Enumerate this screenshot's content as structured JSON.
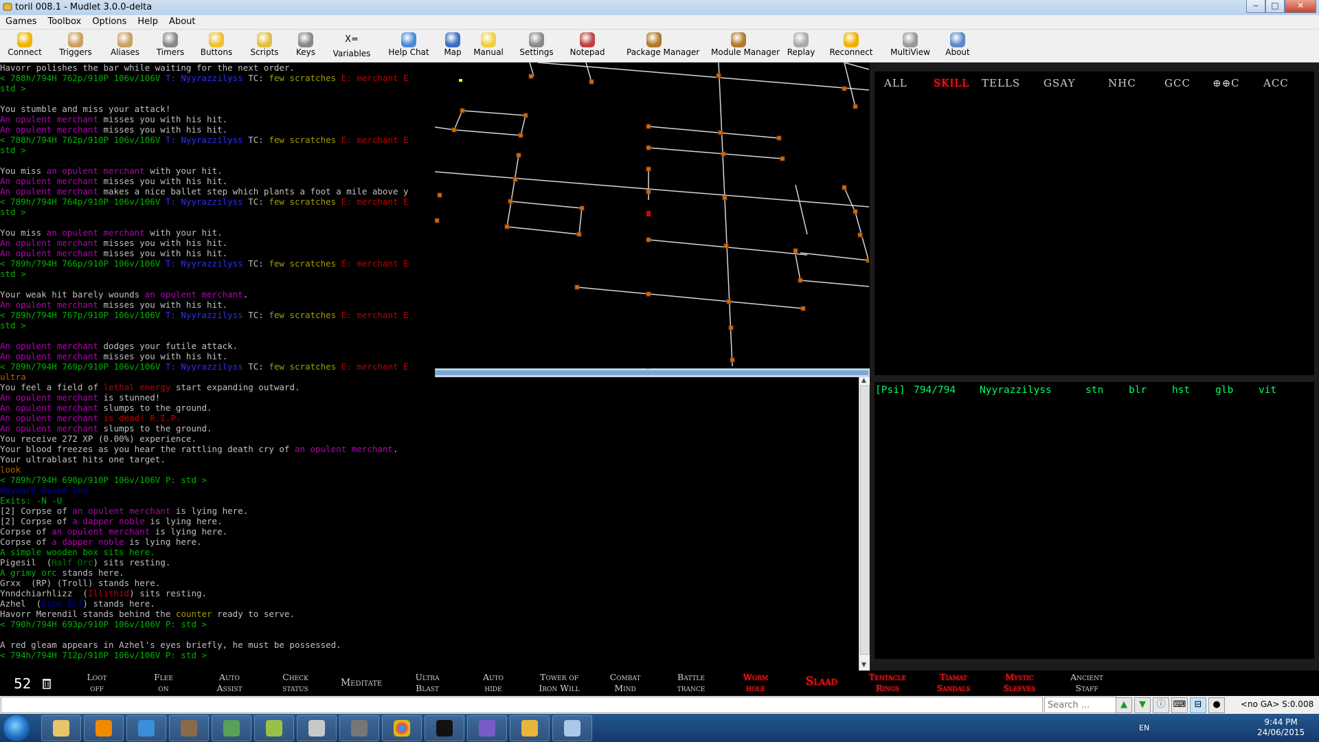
{
  "window": {
    "title": "toril 008.1 - Mudlet 3.0.0-delta",
    "minimize": "‒",
    "maximize": "□",
    "close": "✕"
  },
  "menu": [
    "Games",
    "Toolbox",
    "Options",
    "Help",
    "About"
  ],
  "toolbar": [
    {
      "label": "Connect",
      "icon": "connect-icon"
    },
    {
      "label": "Triggers",
      "icon": "triggers-icon"
    },
    {
      "label": "Aliases",
      "icon": "aliases-icon"
    },
    {
      "label": "Timers",
      "icon": "timers-icon"
    },
    {
      "label": "Buttons",
      "icon": "buttons-icon"
    },
    {
      "label": "Scripts",
      "icon": "scripts-icon"
    },
    {
      "label": "Keys",
      "icon": "keys-icon"
    },
    {
      "label": "Variables",
      "icon": "variables-icon",
      "glyph": "X="
    },
    {
      "label": "Help Chat",
      "icon": "help-chat-icon"
    },
    {
      "label": "Map",
      "icon": "map-icon"
    },
    {
      "label": "Manual",
      "icon": "manual-icon"
    },
    {
      "label": "Settings",
      "icon": "settings-icon"
    },
    {
      "label": "Notepad",
      "icon": "notepad-icon"
    },
    {
      "label": "Package Manager",
      "icon": "package-manager-icon"
    },
    {
      "label": "Module Manager",
      "icon": "module-manager-icon"
    },
    {
      "label": "Replay",
      "icon": "replay-icon"
    },
    {
      "label": "Reconnect",
      "icon": "reconnect-icon"
    },
    {
      "label": "MultiView",
      "icon": "multiview-icon"
    },
    {
      "label": "About",
      "icon": "about-icon"
    }
  ],
  "console": [
    [
      [
        "w",
        "Havorr polishes the bar while waiting for the next order."
      ]
    ],
    [
      [
        "g",
        "< 788h/794H 762p/910P 106v/106V "
      ],
      [
        "b",
        "T: Nyyrazzilyss"
      ],
      [
        "w",
        " TC: "
      ],
      [
        "y",
        "few scratches"
      ],
      [
        "r",
        " E: merchant E"
      ]
    ],
    [
      [
        "g",
        "std >"
      ]
    ],
    [
      [
        "w",
        ""
      ]
    ],
    [
      [
        "w",
        "You stumble and miss your attack!"
      ]
    ],
    [
      [
        "p",
        "An opulent merchant"
      ],
      [
        "w",
        " misses you with his hit."
      ]
    ],
    [
      [
        "p",
        "An opulent merchant"
      ],
      [
        "w",
        " misses you with his hit."
      ]
    ],
    [
      [
        "g",
        "< 788h/794H 762p/910P 106v/106V "
      ],
      [
        "b",
        "T: Nyyrazzilyss"
      ],
      [
        "w",
        " TC: "
      ],
      [
        "y",
        "few scratches"
      ],
      [
        "r",
        " E: merchant E"
      ]
    ],
    [
      [
        "g",
        "std >"
      ]
    ],
    [
      [
        "w",
        ""
      ]
    ],
    [
      [
        "w",
        "You miss "
      ],
      [
        "p",
        "an opulent merchant"
      ],
      [
        "w",
        " with your hit."
      ]
    ],
    [
      [
        "p",
        "An opulent merchant"
      ],
      [
        "w",
        " misses you with his hit."
      ]
    ],
    [
      [
        "p",
        "An opulent merchant"
      ],
      [
        "w",
        " makes a nice ballet step which plants a foot a mile above y"
      ]
    ],
    [
      [
        "g",
        "< 789h/794H 764p/910P 106v/106V "
      ],
      [
        "b",
        "T: Nyyrazzilyss"
      ],
      [
        "w",
        " TC: "
      ],
      [
        "y",
        "few scratches"
      ],
      [
        "r",
        " E: merchant E"
      ]
    ],
    [
      [
        "g",
        "std >"
      ]
    ],
    [
      [
        "w",
        ""
      ]
    ],
    [
      [
        "w",
        "You miss "
      ],
      [
        "p",
        "an opulent merchant"
      ],
      [
        "w",
        " with your hit."
      ]
    ],
    [
      [
        "p",
        "An opulent merchant"
      ],
      [
        "w",
        " misses you with his hit."
      ]
    ],
    [
      [
        "p",
        "An opulent merchant"
      ],
      [
        "w",
        " misses you with his hit."
      ]
    ],
    [
      [
        "g",
        "< 789h/794H 766p/910P 106v/106V "
      ],
      [
        "b",
        "T: Nyyrazzilyss"
      ],
      [
        "w",
        " TC: "
      ],
      [
        "y",
        "few scratches"
      ],
      [
        "r",
        " E: merchant E"
      ]
    ],
    [
      [
        "g",
        "std >"
      ]
    ],
    [
      [
        "w",
        ""
      ]
    ],
    [
      [
        "w",
        "Your weak hit barely wounds "
      ],
      [
        "p",
        "an opulent merchant"
      ],
      [
        "w",
        "."
      ]
    ],
    [
      [
        "p",
        "An opulent merchant"
      ],
      [
        "w",
        " misses you with his hit."
      ]
    ],
    [
      [
        "g",
        "< 789h/794H 767p/910P 106v/106V "
      ],
      [
        "b",
        "T: Nyyrazzilyss"
      ],
      [
        "w",
        " TC: "
      ],
      [
        "y",
        "few scratches"
      ],
      [
        "r",
        " E: merchant E"
      ]
    ],
    [
      [
        "g",
        "std >"
      ]
    ],
    [
      [
        "w",
        ""
      ]
    ],
    [
      [
        "p",
        "An opulent merchant"
      ],
      [
        "w",
        " dodges your futile attack."
      ]
    ],
    [
      [
        "p",
        "An opulent merchant"
      ],
      [
        "w",
        " misses you with his hit."
      ]
    ],
    [
      [
        "g",
        "< 789h/794H 769p/910P 106v/106V "
      ],
      [
        "b",
        "T: Nyyrazzilyss"
      ],
      [
        "w",
        " TC: "
      ],
      [
        "y",
        "few scratches"
      ],
      [
        "r",
        " E: merchant E"
      ]
    ],
    [
      [
        "o",
        "ultra"
      ]
    ],
    [
      [
        "w",
        "You feel a field of "
      ],
      [
        "r",
        "lethal energy"
      ],
      [
        "w",
        " start expanding outward."
      ]
    ],
    [
      [
        "p",
        "An opulent merchant"
      ],
      [
        "w",
        " is stunned!"
      ]
    ],
    [
      [
        "p",
        "An opulent merchant"
      ],
      [
        "w",
        " slumps to the ground."
      ]
    ],
    [
      [
        "p",
        "An opulent merchant"
      ],
      [
        "r",
        " is dead! R.I.P."
      ]
    ],
    [
      [
        "p",
        "An opulent merchant"
      ],
      [
        "w",
        " slumps to the ground."
      ]
    ],
    [
      [
        "w",
        "You receive 272 XP (0.00%) experience."
      ]
    ],
    [
      [
        "w",
        "Your blood freezes as you hear the rattling death cry of "
      ],
      [
        "p",
        "an opulent merchant"
      ],
      [
        "w",
        "."
      ]
    ],
    [
      [
        "w",
        "Your ultrablast hits one target."
      ]
    ],
    [
      [
        "o",
        "look"
      ]
    ],
    [
      [
        "g",
        "< 789h/794H 690p/910P 106v/106V P: std >"
      ]
    ],
    [
      [
        "db",
        "Wayward House Inn"
      ]
    ],
    [
      [
        "g",
        "Exits: -N -U"
      ]
    ],
    [
      [
        "w",
        "[2] Corpse of "
      ],
      [
        "p",
        "an opulent merchant"
      ],
      [
        "w",
        " is lying here."
      ]
    ],
    [
      [
        "w",
        "[2] Corpse of "
      ],
      [
        "p",
        "a dapper noble"
      ],
      [
        "w",
        " is lying here."
      ]
    ],
    [
      [
        "w",
        "Corpse of "
      ],
      [
        "p",
        "an opulent merchant"
      ],
      [
        "w",
        " is lying here."
      ]
    ],
    [
      [
        "w",
        "Corpse of "
      ],
      [
        "p",
        "a dapper noble"
      ],
      [
        "w",
        " is lying here."
      ]
    ],
    [
      [
        "g",
        "A simple wooden box sits here."
      ]
    ],
    [
      [
        "w",
        "Pigesil  ("
      ],
      [
        "dg",
        "Half Orc"
      ],
      [
        "w",
        ") sits resting."
      ]
    ],
    [
      [
        "g",
        "A grimy orc"
      ],
      [
        "w",
        " stands here."
      ]
    ],
    [
      [
        "w",
        "Grxx  (RP) (Troll) stands here."
      ]
    ],
    [
      [
        "w",
        "Ynndchiarhlizz  ("
      ],
      [
        "r",
        "Illithid"
      ],
      [
        "w",
        ") sits resting."
      ]
    ],
    [
      [
        "w",
        "Azhel  ("
      ],
      [
        "db",
        "Drow Elf"
      ],
      [
        "w",
        ") stands here."
      ]
    ],
    [
      [
        "w",
        "Havorr Merendil stands behind the "
      ],
      [
        "y",
        "counter"
      ],
      [
        "w",
        " ready to serve."
      ]
    ],
    [
      [
        "g",
        "< 790h/794H 693p/910P 106v/106V P: std >"
      ]
    ],
    [
      [
        "w",
        ""
      ]
    ],
    [
      [
        "w",
        "A red gleam appears in Azhel's eyes briefly, he must be possessed."
      ]
    ],
    [
      [
        "g",
        "< 794h/794H 712p/910P 106v/106V P: std >"
      ]
    ]
  ],
  "chat_tabs": [
    {
      "label": "ALL",
      "active": false
    },
    {
      "label": "SKILL",
      "active": true
    },
    {
      "label": "TELLS",
      "active": false
    },
    {
      "label": "GSAY",
      "active": false
    },
    {
      "label": "NHC",
      "active": false
    },
    {
      "label": "GCC",
      "active": false
    },
    {
      "label": "⊕⊕C",
      "active": false
    },
    {
      "label": "ACC",
      "active": false
    }
  ],
  "status": {
    "psi": "[Psi]",
    "points": "794/794",
    "name": "Nyyrazzilyss",
    "flags": [
      "stn",
      "blr",
      "hst",
      "glb",
      "vit"
    ]
  },
  "buttonbar": {
    "counter": "52",
    "buttons": [
      {
        "label": "Loot off",
        "red": false
      },
      {
        "label": "Flee on",
        "red": false
      },
      {
        "label": "Auto Assist",
        "red": false
      },
      {
        "label": "Check status",
        "red": false
      },
      {
        "label": "Meditate",
        "red": false
      },
      {
        "label": "Ultra Blast",
        "red": false
      },
      {
        "label": "Auto hide",
        "red": false
      },
      {
        "label": "Tower of Iron Will",
        "red": false
      },
      {
        "label": "Combat Mind",
        "red": false
      },
      {
        "label": "Battle trance",
        "red": false
      },
      {
        "label": "Worm hole",
        "red": true
      },
      {
        "label": "Slaad",
        "red": true
      },
      {
        "label": "Tentacle Rings",
        "red": true
      },
      {
        "label": "Tiamat Sandals",
        "red": true
      },
      {
        "label": "Mystic Sleeves",
        "red": true
      },
      {
        "label": "Ancient Staff",
        "red": false
      }
    ]
  },
  "cmdline": {
    "search_placeholder": "Search ...",
    "ga_status": "<no GA> S:0.008"
  },
  "taskbar": {
    "lang": "EN",
    "time": "9:44 PM",
    "date": "24/06/2015"
  },
  "colors": {
    "w": "#c0c0c0",
    "g": "#00b300",
    "p": "#b600b6",
    "b": "#2d2dff",
    "r": "#c00000",
    "y": "#a0a000",
    "o": "#b06000",
    "dg": "#007a00",
    "db": "#0000a8",
    "status": "#00ff60",
    "button_red": "#ff2020"
  }
}
